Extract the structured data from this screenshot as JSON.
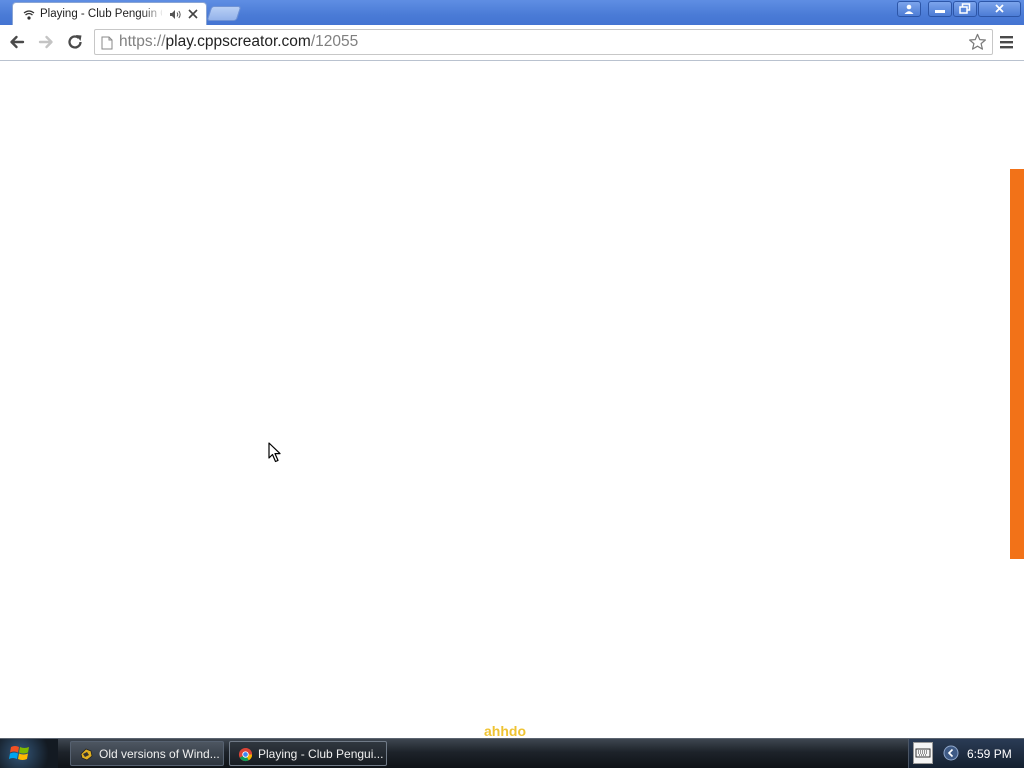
{
  "browser": {
    "tab": {
      "title": "Playing - Club Penguin Cl"
    },
    "address_bar": {
      "scheme": "https://",
      "host": "play.cppscreator.com",
      "path": "/12055"
    }
  },
  "page": {
    "watermark": "ahhdo",
    "accent_color": "#f27218",
    "watermark_color": "#efc332"
  },
  "taskbar": {
    "tasks": [
      {
        "label": "Old versions of Wind...",
        "icon": "winamp-icon"
      },
      {
        "label": "Playing - Club Pengui...",
        "icon": "chrome-icon"
      }
    ],
    "clock": "6:59 PM"
  }
}
